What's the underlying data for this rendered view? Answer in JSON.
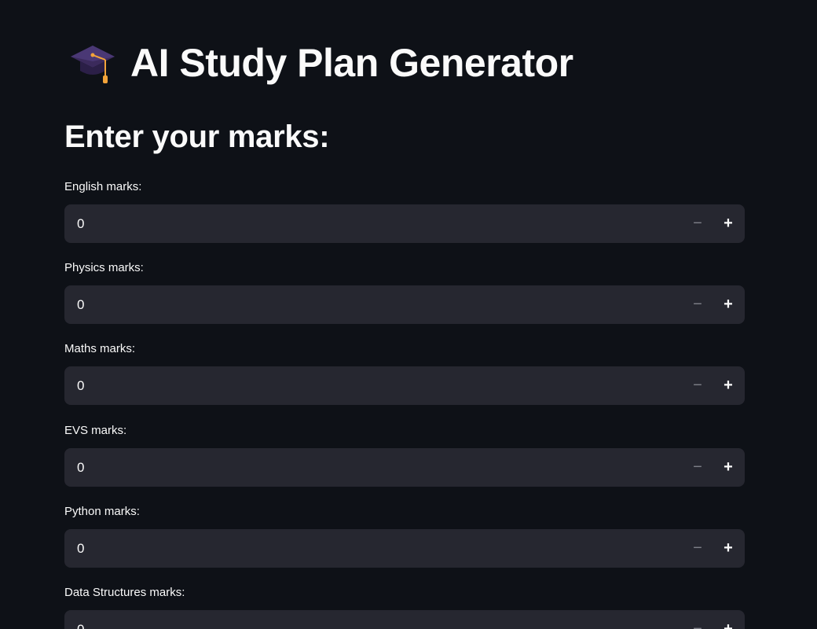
{
  "app": {
    "title": "AI Study Plan Generator",
    "title_icon": "graduation-cap-icon"
  },
  "form": {
    "heading": "Enter your marks:",
    "fields": [
      {
        "label": "English marks:",
        "value": "0"
      },
      {
        "label": "Physics marks:",
        "value": "0"
      },
      {
        "label": "Maths marks:",
        "value": "0"
      },
      {
        "label": "EVS marks:",
        "value": "0"
      },
      {
        "label": "Python marks:",
        "value": "0"
      },
      {
        "label": "Data Structures marks:",
        "value": "0"
      }
    ],
    "decrement_symbol": "−",
    "increment_symbol": "+"
  },
  "colors": {
    "background": "#0e1117",
    "input_background": "#262730",
    "text": "#fafafa",
    "disabled": "#7d7f87"
  }
}
